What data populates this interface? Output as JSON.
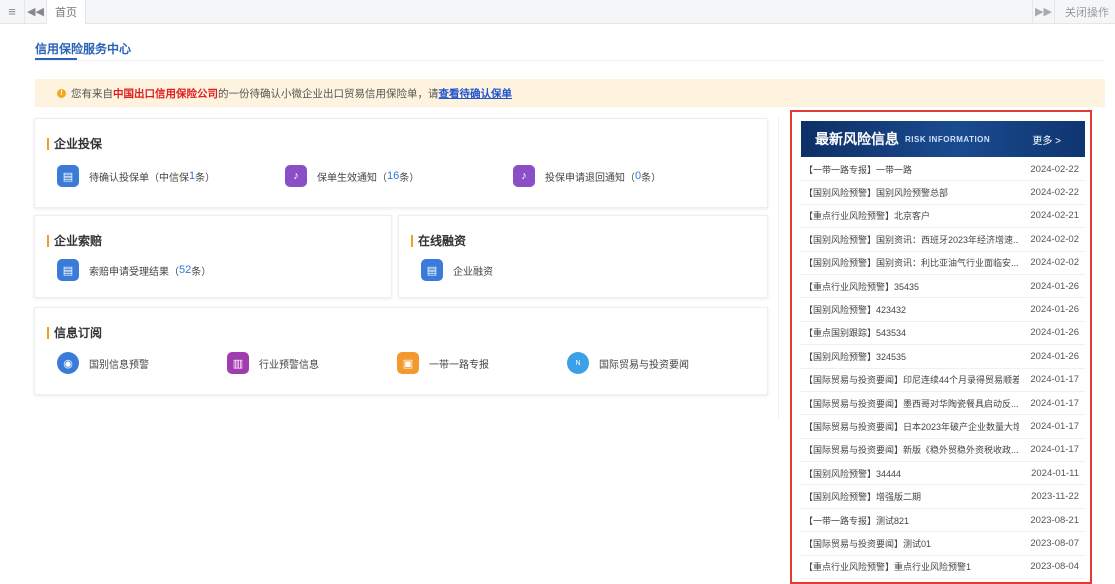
{
  "topbar": {
    "menu_icon": "≡",
    "back_icon": "◀◀",
    "home_tab": "首页",
    "forward_icon": "▶▶",
    "close_ops": "关闭操作"
  },
  "page": {
    "title": "信用保险服务中心"
  },
  "notice": {
    "prefix": "您有来自",
    "company": "中国出口信用保险公司",
    "middle": "的一份待确认小微企业出口贸易信用保险单，请",
    "link": "查看待确认保单"
  },
  "sections": {
    "insure": {
      "title": "企业投保",
      "items": [
        {
          "label": "待确认投保单（中信保 ",
          "count": "1",
          "suffix": " 条）"
        },
        {
          "label": "保单生效通知（",
          "count": "16",
          "suffix": " 条）"
        },
        {
          "label": "投保申请退回通知（",
          "count": "0",
          "suffix": " 条）"
        }
      ]
    },
    "claim": {
      "title": "企业索赔",
      "item": {
        "label": "索赔申请受理结果（",
        "count": "52",
        "suffix": " 条）"
      }
    },
    "finance": {
      "title": "在线融资",
      "item": {
        "label": "企业融资"
      }
    },
    "subscribe": {
      "title": "信息订阅",
      "items": [
        {
          "label": "国别信息预警"
        },
        {
          "label": "行业预警信息"
        },
        {
          "label": "一带一路专报"
        },
        {
          "label": "国际贸易与投资要闻"
        }
      ]
    }
  },
  "risk": {
    "title": "最新风险信息",
    "subtitle": "RISK INFORMATION",
    "more": "更多 >",
    "items": [
      {
        "title": "【一带一路专报】一带一路",
        "date": "2024-02-22"
      },
      {
        "title": "【国别风险预警】国别风险预警总部",
        "date": "2024-02-22"
      },
      {
        "title": "【重点行业风险预警】北京客户",
        "date": "2024-02-21"
      },
      {
        "title": "【国别风险预警】国别资讯：西班牙2023年经济增速...",
        "date": "2024-02-02"
      },
      {
        "title": "【国别风险预警】国别资讯：利比亚油气行业面临安...",
        "date": "2024-02-02"
      },
      {
        "title": "【重点行业风险预警】35435",
        "date": "2024-01-26"
      },
      {
        "title": "【国别风险预警】423432",
        "date": "2024-01-26"
      },
      {
        "title": "【重点国别跟踪】543534",
        "date": "2024-01-26"
      },
      {
        "title": "【国别风险预警】324535",
        "date": "2024-01-26"
      },
      {
        "title": "【国际贸易与投资要闻】印尼连续44个月录得贸易顺差",
        "date": "2024-01-17"
      },
      {
        "title": "【国际贸易与投资要闻】墨西哥对华陶瓷餐具启动反...",
        "date": "2024-01-17"
      },
      {
        "title": "【国际贸易与投资要闻】日本2023年破产企业数量大增",
        "date": "2024-01-17"
      },
      {
        "title": "【国际贸易与投资要闻】新版《稳外贸稳外资税收政...",
        "date": "2024-01-17"
      },
      {
        "title": "【国别风险预警】34444",
        "date": "2024-01-11"
      },
      {
        "title": "【国别风险预警】增强版二期",
        "date": "2023-11-22"
      },
      {
        "title": "【一带一路专报】测试821",
        "date": "2023-08-21"
      },
      {
        "title": "【国际贸易与投资要闻】测试01",
        "date": "2023-08-07"
      },
      {
        "title": "【重点行业风险预警】重点行业风险预警1",
        "date": "2023-08-04"
      }
    ]
  },
  "colors": {
    "accent": "#2b63b8",
    "count": "#2b7bd6",
    "notice_bg": "#fdf3df",
    "company": "#e02020",
    "highlight_border": "#e53935",
    "risk_header": "#0e2f67"
  }
}
